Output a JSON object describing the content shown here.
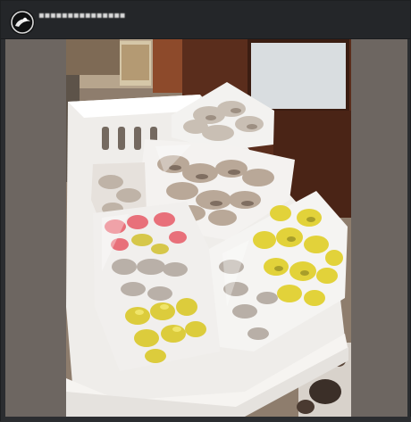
{
  "post": {
    "author": {
      "name": "▪▪▪▪▪▪▪▪▪▪▪▪▪▪▪",
      "avatar_icon": "profile-avatar-icon"
    },
    "media": {
      "kind": "photo"
    }
  },
  "colors": {
    "header_bg": "#242629",
    "page_bg": "#2b2d30",
    "letterbox": "#6d6661",
    "basket": "#f1efec",
    "yellow_mushroom": "#e2d23a",
    "pink_mushroom": "#e8707a",
    "grey_mushroom": "#c8bdb2"
  }
}
